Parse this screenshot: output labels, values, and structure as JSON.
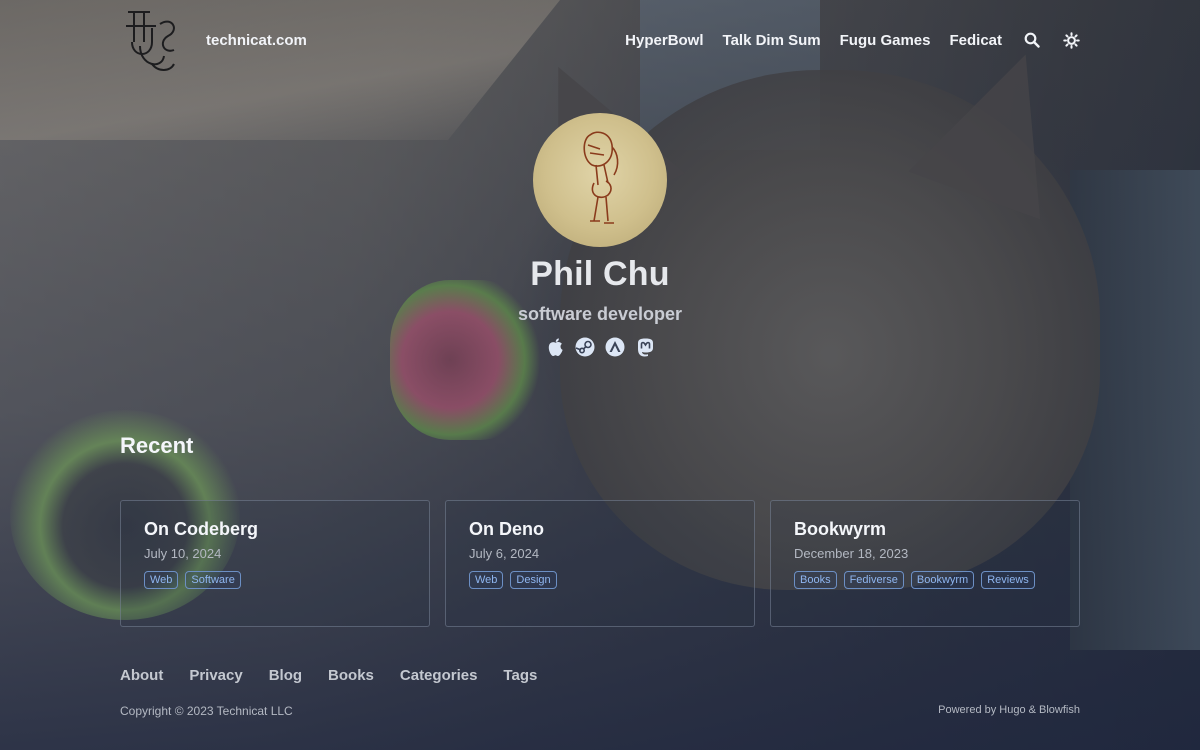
{
  "header": {
    "site_name": "technicat.com",
    "logo_icon": "technicat-logo-icon",
    "nav": [
      {
        "label": "HyperBowl"
      },
      {
        "label": "Talk Dim Sum"
      },
      {
        "label": "Fugu Games"
      },
      {
        "label": "Fedicat"
      }
    ],
    "search_icon": "search-icon",
    "theme_icon": "sun-icon"
  },
  "profile": {
    "name": "Phil Chu",
    "tagline": "software developer",
    "socials": [
      "apple-icon",
      "steam-icon",
      "linktree-icon",
      "mastodon-icon"
    ]
  },
  "recent": {
    "title": "Recent",
    "cards": [
      {
        "title": "On Codeberg",
        "date": "July 10, 2024",
        "tags": [
          "Web",
          "Software"
        ]
      },
      {
        "title": "On Deno",
        "date": "July 6, 2024",
        "tags": [
          "Web",
          "Design"
        ]
      },
      {
        "title": "Bookwyrm",
        "date": "December 18, 2023",
        "tags": [
          "Books",
          "Fediverse",
          "Bookwyrm",
          "Reviews"
        ]
      }
    ]
  },
  "footer": {
    "links": [
      "About",
      "Privacy",
      "Blog",
      "Books",
      "Categories",
      "Tags"
    ],
    "copyright": "Copyright © 2023 Technicat LLC",
    "powered": "Powered by Hugo & Blowfish"
  },
  "colors": {
    "tag_text": "#8fb6f0",
    "tag_border": "#6c8fc4",
    "card_border": "#78849a"
  }
}
